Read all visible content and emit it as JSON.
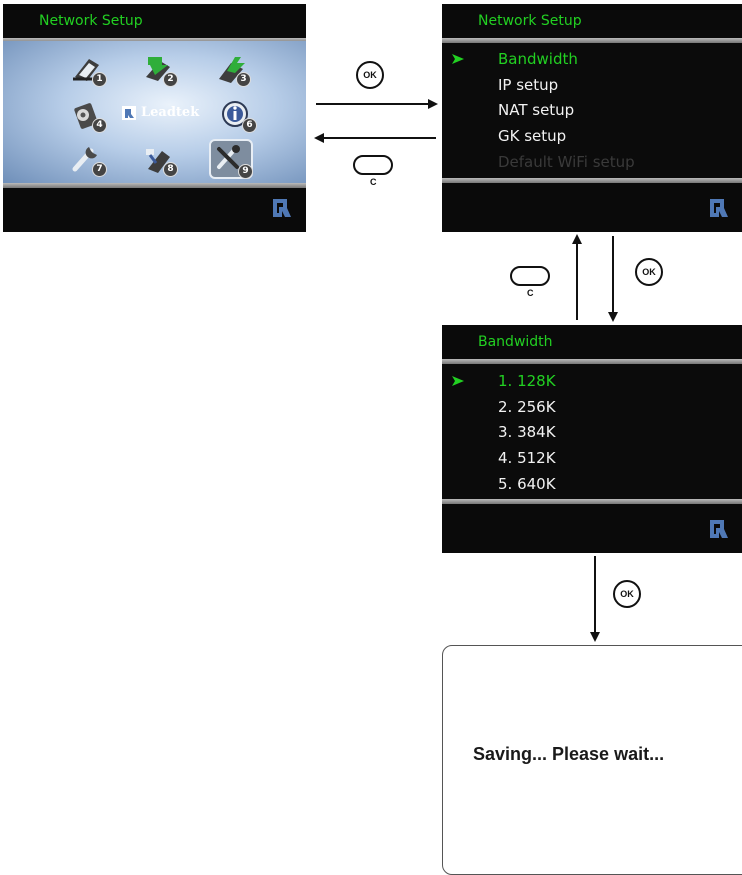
{
  "screen1": {
    "title": "Network Setup",
    "logo_text": "Leadtek",
    "tiles": [
      {
        "icon": "phonebook-icon",
        "num": "1"
      },
      {
        "icon": "incoming-call-icon",
        "num": "2"
      },
      {
        "icon": "outgoing-call-icon",
        "num": "3"
      },
      {
        "icon": "settings-gear-icon",
        "num": "4"
      },
      {
        "icon": "info-icon",
        "num": "6"
      },
      {
        "icon": "tools-icon",
        "num": "7"
      },
      {
        "icon": "network-icon",
        "num": "8"
      },
      {
        "icon": "network-setup-icon",
        "num": "9"
      }
    ]
  },
  "screen2": {
    "title": "Network Setup",
    "items": [
      "Bandwidth",
      "IP setup",
      "NAT setup",
      "GK setup",
      "Default WiFi setup"
    ]
  },
  "screen3": {
    "title": "Bandwidth",
    "items": [
      "1. 128K",
      "2. 256K",
      "3. 384K",
      "4. 512K",
      "5. 640K"
    ]
  },
  "dialog": {
    "message": "Saving... Please wait..."
  },
  "keys": {
    "ok_label": "OK",
    "c_label": "C"
  },
  "colors": {
    "highlight": "#22d022",
    "menu_text": "#f2f2f2",
    "screen_bg": "#0b0b0b",
    "brand": "#4f78b5"
  }
}
